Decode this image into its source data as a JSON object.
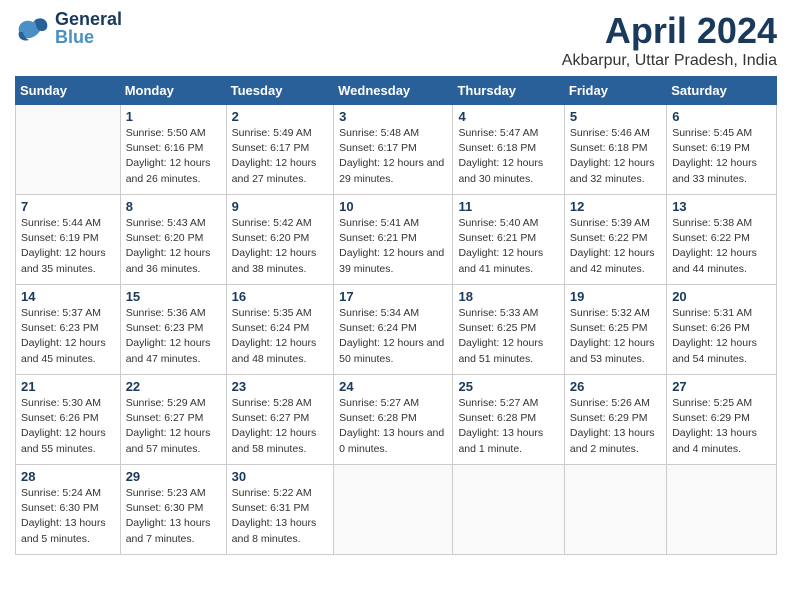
{
  "header": {
    "logo_general": "General",
    "logo_blue": "Blue",
    "main_title": "April 2024",
    "sub_title": "Akbarpur, Uttar Pradesh, India"
  },
  "weekdays": [
    "Sunday",
    "Monday",
    "Tuesday",
    "Wednesday",
    "Thursday",
    "Friday",
    "Saturday"
  ],
  "weeks": [
    {
      "cells": [
        {
          "day": "",
          "empty": true
        },
        {
          "day": "1",
          "sunrise": "Sunrise: 5:50 AM",
          "sunset": "Sunset: 6:16 PM",
          "daylight": "Daylight: 12 hours and 26 minutes."
        },
        {
          "day": "2",
          "sunrise": "Sunrise: 5:49 AM",
          "sunset": "Sunset: 6:17 PM",
          "daylight": "Daylight: 12 hours and 27 minutes."
        },
        {
          "day": "3",
          "sunrise": "Sunrise: 5:48 AM",
          "sunset": "Sunset: 6:17 PM",
          "daylight": "Daylight: 12 hours and 29 minutes."
        },
        {
          "day": "4",
          "sunrise": "Sunrise: 5:47 AM",
          "sunset": "Sunset: 6:18 PM",
          "daylight": "Daylight: 12 hours and 30 minutes."
        },
        {
          "day": "5",
          "sunrise": "Sunrise: 5:46 AM",
          "sunset": "Sunset: 6:18 PM",
          "daylight": "Daylight: 12 hours and 32 minutes."
        },
        {
          "day": "6",
          "sunrise": "Sunrise: 5:45 AM",
          "sunset": "Sunset: 6:19 PM",
          "daylight": "Daylight: 12 hours and 33 minutes."
        }
      ]
    },
    {
      "cells": [
        {
          "day": "7",
          "sunrise": "Sunrise: 5:44 AM",
          "sunset": "Sunset: 6:19 PM",
          "daylight": "Daylight: 12 hours and 35 minutes."
        },
        {
          "day": "8",
          "sunrise": "Sunrise: 5:43 AM",
          "sunset": "Sunset: 6:20 PM",
          "daylight": "Daylight: 12 hours and 36 minutes."
        },
        {
          "day": "9",
          "sunrise": "Sunrise: 5:42 AM",
          "sunset": "Sunset: 6:20 PM",
          "daylight": "Daylight: 12 hours and 38 minutes."
        },
        {
          "day": "10",
          "sunrise": "Sunrise: 5:41 AM",
          "sunset": "Sunset: 6:21 PM",
          "daylight": "Daylight: 12 hours and 39 minutes."
        },
        {
          "day": "11",
          "sunrise": "Sunrise: 5:40 AM",
          "sunset": "Sunset: 6:21 PM",
          "daylight": "Daylight: 12 hours and 41 minutes."
        },
        {
          "day": "12",
          "sunrise": "Sunrise: 5:39 AM",
          "sunset": "Sunset: 6:22 PM",
          "daylight": "Daylight: 12 hours and 42 minutes."
        },
        {
          "day": "13",
          "sunrise": "Sunrise: 5:38 AM",
          "sunset": "Sunset: 6:22 PM",
          "daylight": "Daylight: 12 hours and 44 minutes."
        }
      ]
    },
    {
      "cells": [
        {
          "day": "14",
          "sunrise": "Sunrise: 5:37 AM",
          "sunset": "Sunset: 6:23 PM",
          "daylight": "Daylight: 12 hours and 45 minutes."
        },
        {
          "day": "15",
          "sunrise": "Sunrise: 5:36 AM",
          "sunset": "Sunset: 6:23 PM",
          "daylight": "Daylight: 12 hours and 47 minutes."
        },
        {
          "day": "16",
          "sunrise": "Sunrise: 5:35 AM",
          "sunset": "Sunset: 6:24 PM",
          "daylight": "Daylight: 12 hours and 48 minutes."
        },
        {
          "day": "17",
          "sunrise": "Sunrise: 5:34 AM",
          "sunset": "Sunset: 6:24 PM",
          "daylight": "Daylight: 12 hours and 50 minutes."
        },
        {
          "day": "18",
          "sunrise": "Sunrise: 5:33 AM",
          "sunset": "Sunset: 6:25 PM",
          "daylight": "Daylight: 12 hours and 51 minutes."
        },
        {
          "day": "19",
          "sunrise": "Sunrise: 5:32 AM",
          "sunset": "Sunset: 6:25 PM",
          "daylight": "Daylight: 12 hours and 53 minutes."
        },
        {
          "day": "20",
          "sunrise": "Sunrise: 5:31 AM",
          "sunset": "Sunset: 6:26 PM",
          "daylight": "Daylight: 12 hours and 54 minutes."
        }
      ]
    },
    {
      "cells": [
        {
          "day": "21",
          "sunrise": "Sunrise: 5:30 AM",
          "sunset": "Sunset: 6:26 PM",
          "daylight": "Daylight: 12 hours and 55 minutes."
        },
        {
          "day": "22",
          "sunrise": "Sunrise: 5:29 AM",
          "sunset": "Sunset: 6:27 PM",
          "daylight": "Daylight: 12 hours and 57 minutes."
        },
        {
          "day": "23",
          "sunrise": "Sunrise: 5:28 AM",
          "sunset": "Sunset: 6:27 PM",
          "daylight": "Daylight: 12 hours and 58 minutes."
        },
        {
          "day": "24",
          "sunrise": "Sunrise: 5:27 AM",
          "sunset": "Sunset: 6:28 PM",
          "daylight": "Daylight: 13 hours and 0 minutes."
        },
        {
          "day": "25",
          "sunrise": "Sunrise: 5:27 AM",
          "sunset": "Sunset: 6:28 PM",
          "daylight": "Daylight: 13 hours and 1 minute."
        },
        {
          "day": "26",
          "sunrise": "Sunrise: 5:26 AM",
          "sunset": "Sunset: 6:29 PM",
          "daylight": "Daylight: 13 hours and 2 minutes."
        },
        {
          "day": "27",
          "sunrise": "Sunrise: 5:25 AM",
          "sunset": "Sunset: 6:29 PM",
          "daylight": "Daylight: 13 hours and 4 minutes."
        }
      ]
    },
    {
      "cells": [
        {
          "day": "28",
          "sunrise": "Sunrise: 5:24 AM",
          "sunset": "Sunset: 6:30 PM",
          "daylight": "Daylight: 13 hours and 5 minutes."
        },
        {
          "day": "29",
          "sunrise": "Sunrise: 5:23 AM",
          "sunset": "Sunset: 6:30 PM",
          "daylight": "Daylight: 13 hours and 7 minutes."
        },
        {
          "day": "30",
          "sunrise": "Sunrise: 5:22 AM",
          "sunset": "Sunset: 6:31 PM",
          "daylight": "Daylight: 13 hours and 8 minutes."
        },
        {
          "day": "",
          "empty": true
        },
        {
          "day": "",
          "empty": true
        },
        {
          "day": "",
          "empty": true
        },
        {
          "day": "",
          "empty": true
        }
      ]
    }
  ]
}
